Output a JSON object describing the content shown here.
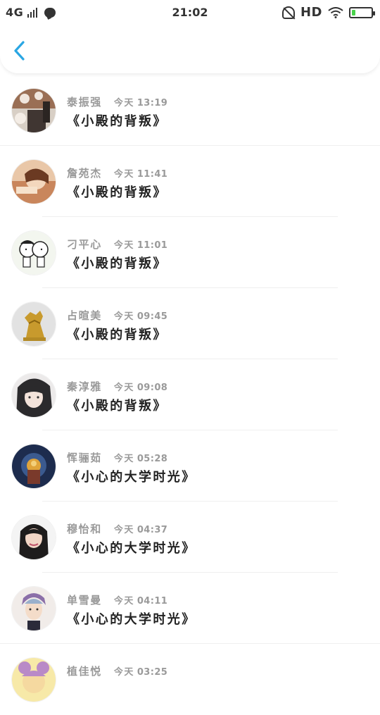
{
  "status_bar": {
    "network": "4G",
    "time": "21:02",
    "hd_label": "HD",
    "battery_level": 0.2,
    "battery_color": "#48d24a"
  },
  "header": {
    "back_icon": "chevron-left-icon",
    "accent_color": "#2aa6e3"
  },
  "items": [
    {
      "name": "泰振强",
      "day": "今天",
      "time": "13:19",
      "title": "《小殿的背叛》"
    },
    {
      "name": "詹苑杰",
      "day": "今天",
      "time": "11:41",
      "title": "《小殿的背叛》"
    },
    {
      "name": "刁平心",
      "day": "今天",
      "time": "11:01",
      "title": "《小殿的背叛》"
    },
    {
      "name": "占暄美",
      "day": "今天",
      "time": "09:45",
      "title": "《小殿的背叛》"
    },
    {
      "name": "秦淳雅",
      "day": "今天",
      "time": "09:08",
      "title": "《小殿的背叛》"
    },
    {
      "name": "恽骊茹",
      "day": "今天",
      "time": "05:28",
      "title": "《小心的大学时光》"
    },
    {
      "name": "穆怡和",
      "day": "今天",
      "time": "04:37",
      "title": "《小心的大学时光》"
    },
    {
      "name": "单雪曼",
      "day": "今天",
      "time": "04:11",
      "title": "《小心的大学时光》"
    },
    {
      "name": "植佳悦",
      "day": "今天",
      "time": "03:25",
      "title": ""
    }
  ]
}
